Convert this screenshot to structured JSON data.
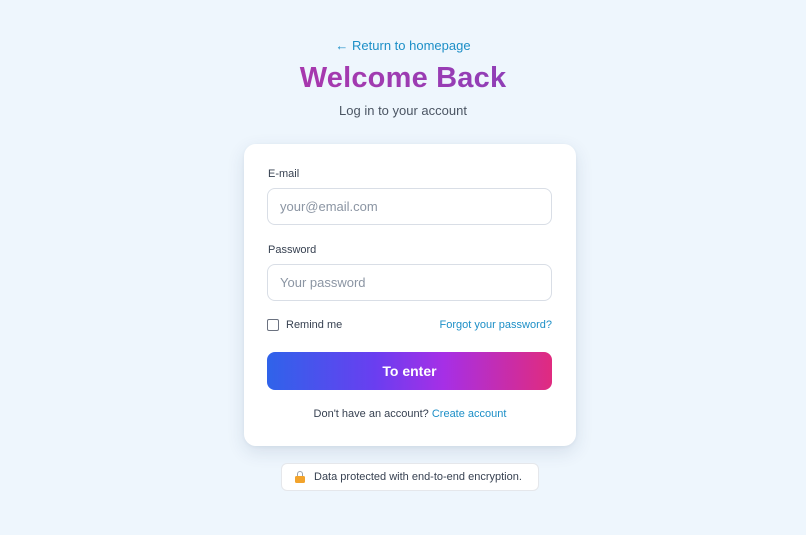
{
  "header": {
    "back_link": "← Return to homepage",
    "title": "Welcome Back",
    "subtitle": "Log in to your account"
  },
  "form": {
    "email_label": "E-mail",
    "email_placeholder": "your@email.com",
    "email_value": "",
    "password_label": "Password",
    "password_placeholder": "Your password",
    "password_value": "",
    "remind_label": "Remind me",
    "remind_checked": false,
    "forgot_link": "Forgot your password?",
    "submit_label": "To enter",
    "signup_prompt": "Don't have an account?",
    "signup_link": "Create account"
  },
  "footer": {
    "security_notice": "Data protected with end-to-end encryption.",
    "notice_icon": "lock-icon"
  },
  "colors": {
    "background": "#eef6fd",
    "link": "#1d8fc7",
    "title_gradient_start": "#c026a3",
    "title_gradient_end": "#6a44c4",
    "button_gradient_start": "#2f63ea",
    "button_gradient_end": "#e02b7f"
  }
}
